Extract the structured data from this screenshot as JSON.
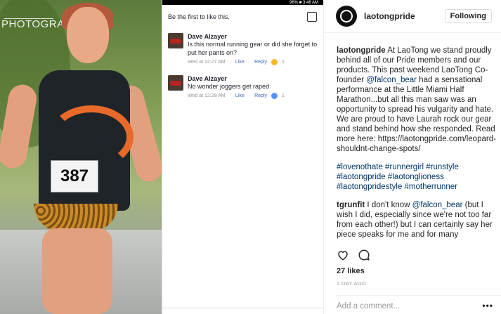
{
  "photo": {
    "watermark": "PHOTOGRAPHY",
    "bib_number": "387"
  },
  "facebook": {
    "status_battery": "96% ■ 3:46 AM",
    "first_to_like": "Be the first to like this.",
    "comments": [
      {
        "name": "Dave Alzayer",
        "text": "Is this normal running gear or did she forget to put her pants on?",
        "time": "Wed at 12:27 AM",
        "like": "Like",
        "reply": "Reply",
        "reaction_color": "#f7b928",
        "count": "1"
      },
      {
        "name": "Dave Alzayer",
        "text": "No wonder joggers get raped",
        "time": "Wed at 12:28 AM",
        "like": "Like",
        "reply": "Reply",
        "reaction_color": "#5890ff",
        "count": "1"
      }
    ]
  },
  "instagram": {
    "username": "laotongpride",
    "follow_label": "Following",
    "caption_user": "laotongpride",
    "caption_1": " At LaoTong we stand proudly behind all of our Pride members and our products. This past weekend LaoTong Co-founder ",
    "caption_mention": "@falcon_bear",
    "caption_2": " had a sensational performance at the Little Miami Half Marathon...but all this man saw was an opportunity to spread his vulgarity and hate. We are proud to have Laurah rock our gear and stand behind how she responded. Read more here: https://laotongpride.com/leopard-shouldnt-change-spots/",
    "hashtags": "#lovenothate #runnergirl #runstyle #laotongpride #laotonglioness #laotongpridestyle #motherrunner",
    "comment_user": "tgrunfit",
    "comment_1": " I don't know ",
    "comment_mention": "@falcon_bear",
    "comment_2": " (but I wish I did, especially since we're not too far from each other!) but I can certainly say her piece speaks for me and for many",
    "likes": "27 likes",
    "timestamp": "1 DAY AGO",
    "add_comment_placeholder": "Add a comment...",
    "more": "•••"
  }
}
